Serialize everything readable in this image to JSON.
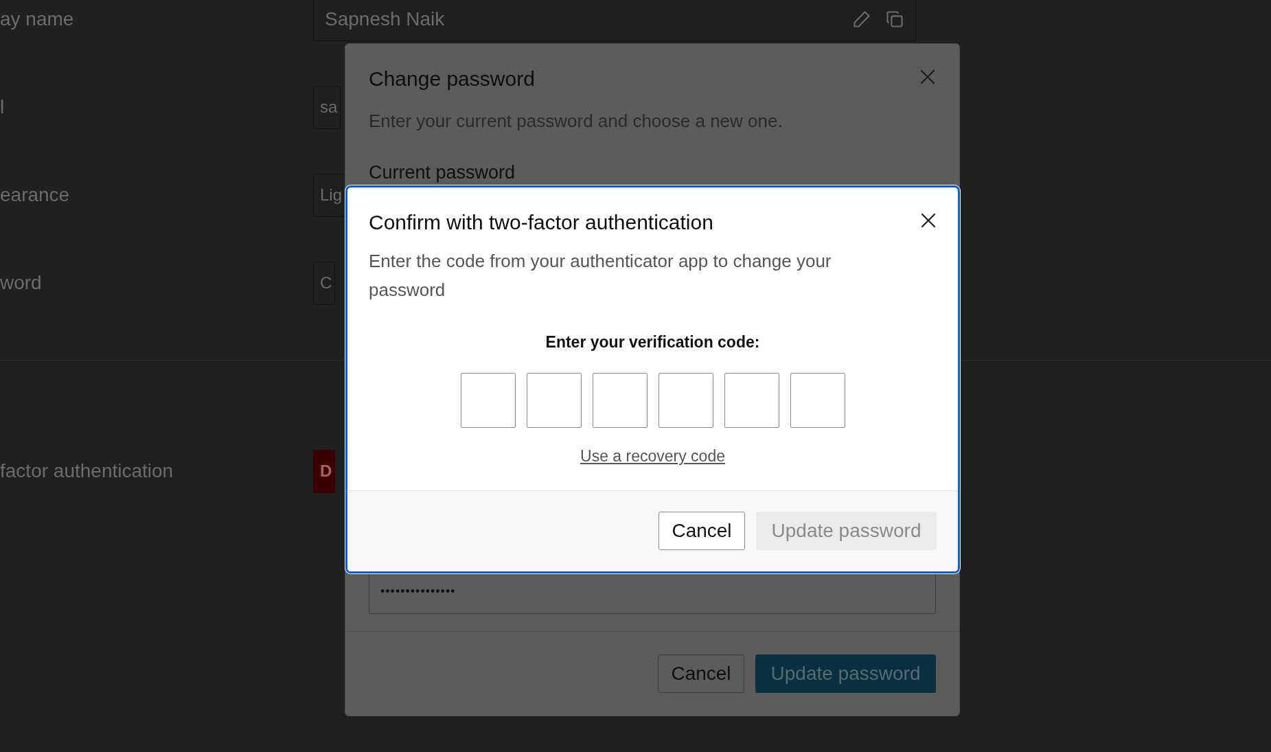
{
  "settings": {
    "rows": [
      {
        "label": "ay name",
        "value": "Sapnesh Naik",
        "kind": "name"
      },
      {
        "label": "l",
        "value": "sa",
        "kind": "field"
      },
      {
        "label": "earance",
        "value": "Lig",
        "kind": "field"
      },
      {
        "label": "word",
        "value": "C",
        "kind": "button"
      },
      {
        "label": "factor authentication",
        "value": "D",
        "kind": "danger"
      }
    ]
  },
  "change_password_dialog": {
    "title": "Change password",
    "subtitle": "Enter your current password and choose a new one.",
    "current_password_label": "Current password",
    "password_value": "•••••••••••••••",
    "buttons": [
      {
        "label": "Cancel",
        "kind": "secondary"
      },
      {
        "label": "Update password",
        "kind": "primary"
      }
    ]
  },
  "two_factor_dialog": {
    "title": "Confirm with two-factor authentication",
    "description": "Enter the code from your authenticator app to change your password",
    "code_label": "Enter your verification code:",
    "code_boxes": [
      {
        "selected": false
      },
      {
        "selected": false
      },
      {
        "selected": false
      },
      {
        "selected": false
      },
      {
        "selected": false
      },
      {
        "selected": false
      }
    ],
    "recovery_link": "Use a recovery code",
    "buttons": [
      {
        "label": "Cancel",
        "kind": "secondary"
      },
      {
        "label": "Update password",
        "kind": "disabled"
      }
    ]
  }
}
